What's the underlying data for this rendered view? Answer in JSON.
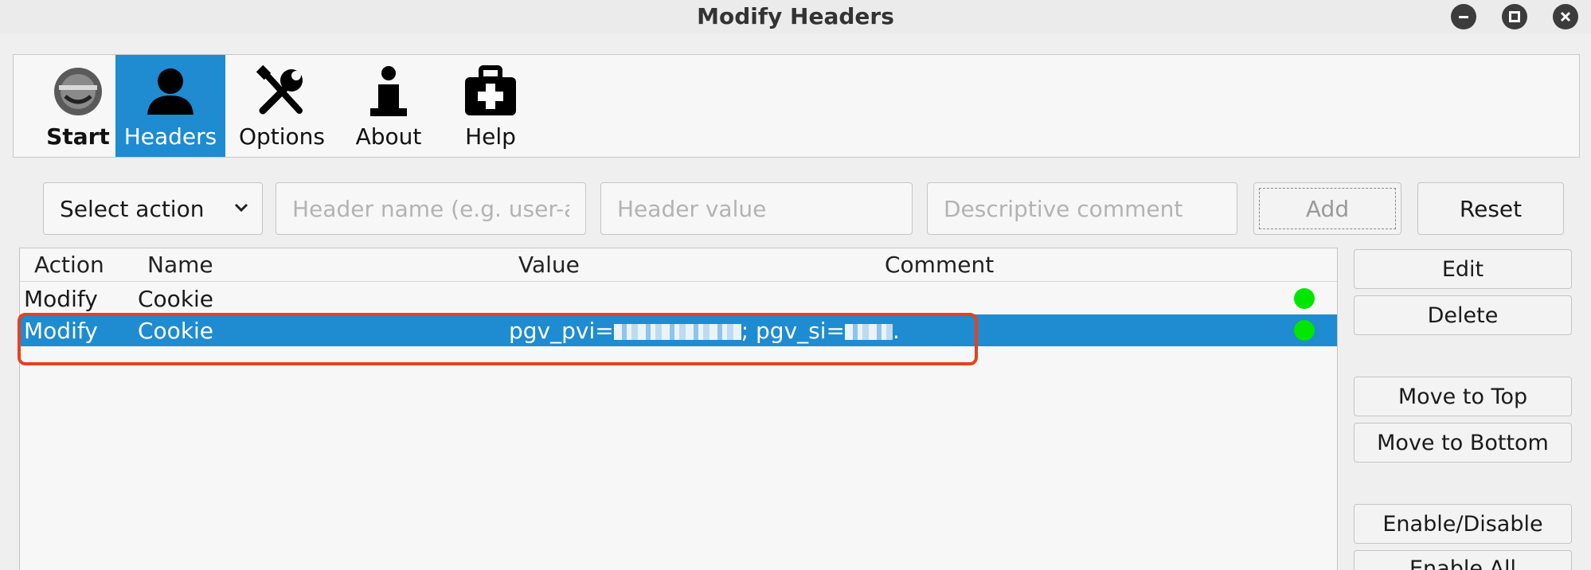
{
  "window": {
    "title": "Modify Headers"
  },
  "toolbar": {
    "items": [
      {
        "label": "Start",
        "icon": "start-icon"
      },
      {
        "label": "Headers",
        "icon": "user-icon",
        "active": true
      },
      {
        "label": "Options",
        "icon": "tools-icon"
      },
      {
        "label": "About",
        "icon": "info-icon"
      },
      {
        "label": "Help",
        "icon": "first-aid-icon"
      }
    ]
  },
  "form": {
    "action_select": "Select action",
    "name_placeholder": "Header name (e.g. user-ag",
    "value_placeholder": "Header value",
    "comment_placeholder": "Descriptive comment",
    "add_label": "Add",
    "reset_label": "Reset"
  },
  "table": {
    "columns": [
      "Action",
      "Name",
      "Value",
      "Comment"
    ],
    "rows": [
      {
        "action": "Modify",
        "name": "Cookie",
        "value": "",
        "comment": "",
        "status": "enabled"
      },
      {
        "action": "Modify",
        "name": "Cookie",
        "value_prefix": "pgv_pvi=",
        "value_mid": "; pgv_si=",
        "value_end": ".",
        "comment": "",
        "status": "enabled",
        "selected": true
      }
    ]
  },
  "side_buttons": {
    "edit": "Edit",
    "delete": "Delete",
    "move_top": "Move to Top",
    "move_bottom": "Move to Bottom",
    "enable_disable": "Enable/Disable",
    "enable_all": "Enable All"
  },
  "colors": {
    "accent": "#1f8bd0",
    "status_on": "#00e600",
    "highlight": "#e8401f"
  }
}
